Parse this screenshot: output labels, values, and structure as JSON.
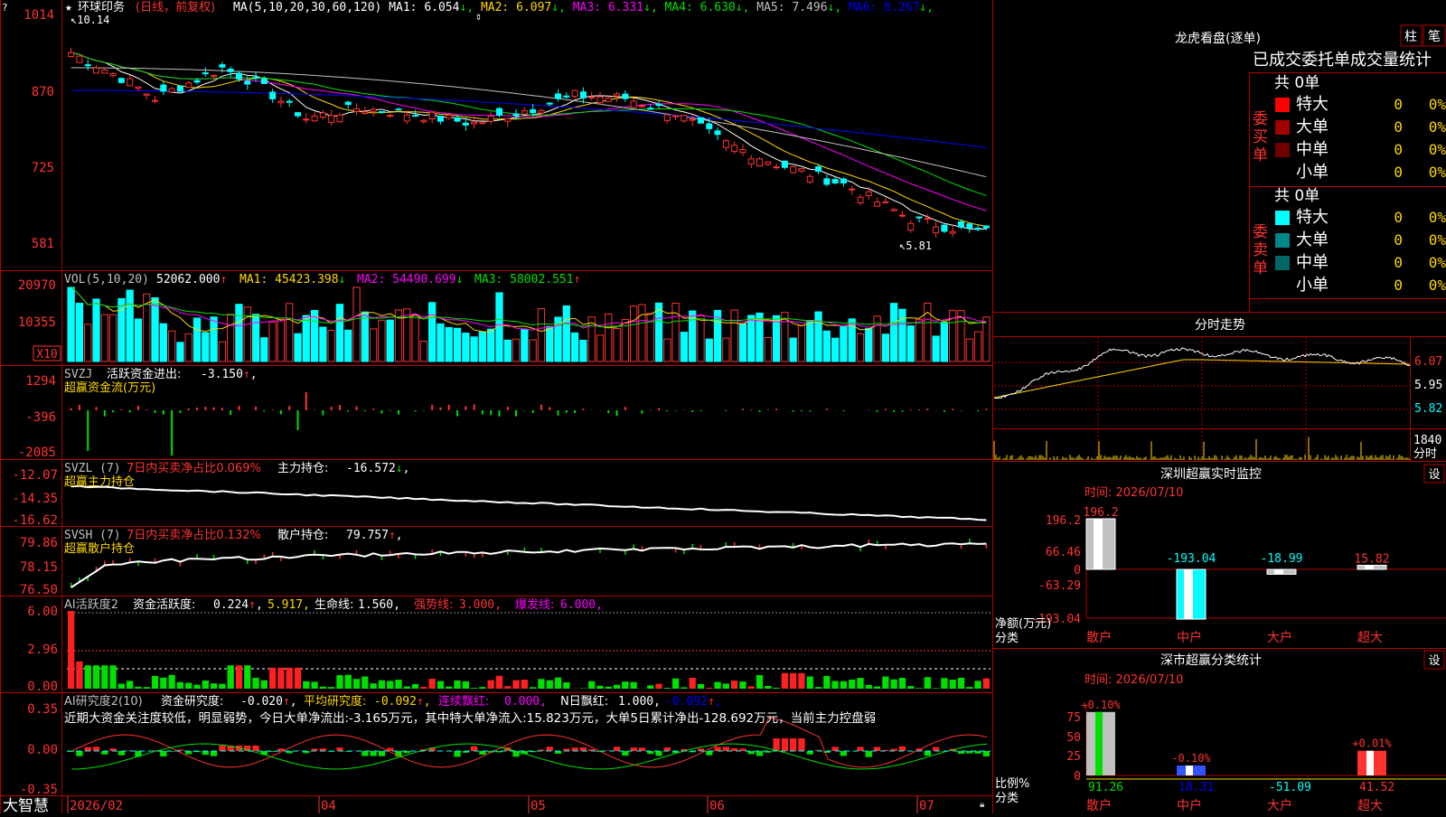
{
  "colors": {
    "up": "#ff3232",
    "down": "#00ffff",
    "green": "#00e000",
    "border": "#b00000",
    "yellow": "#ffd700",
    "white": "#ffffff",
    "magenta": "#ff00ff",
    "cyan": "#00ffff",
    "blue": "#0000ff",
    "gray": "#c0c0c0",
    "greenline": "#00c000"
  },
  "app": {
    "brand": "大智慧",
    "question_mark": "?"
  },
  "main": {
    "stock_name": "环球印务",
    "mode": "(日线，前复权)",
    "ma_label": "MA(5,10,20,30,60,120)",
    "ma_values": [
      {
        "key": "MA1:",
        "value": "6.054",
        "arrow": "↓",
        "color": "#ffffff"
      },
      {
        "key": "MA2:",
        "value": "6.097",
        "arrow": "↓",
        "color": "#ffd700"
      },
      {
        "key": "MA3:",
        "value": "6.331",
        "arrow": "↓",
        "color": "#ff00ff"
      },
      {
        "key": "MA4:",
        "value": "6.630",
        "arrow": "↓",
        "color": "#00e000"
      },
      {
        "key": "MA5:",
        "value": "7.496",
        "arrow": "↓",
        "color": "#c0c0c0"
      },
      {
        "key": "MA6:",
        "value": "8.267",
        "arrow": "↓",
        "color": "#0000ff"
      }
    ],
    "y_ticks": [
      "1014",
      "870",
      "725",
      "581"
    ],
    "high_label": "10.14",
    "low_label": "5.81"
  },
  "vol": {
    "label": "VOL(5,10,20)",
    "value": "52062.000",
    "arrow": "↑",
    "ma1": "MA1: 45423.398",
    "ma1_arrow": "↓",
    "ma2": "MA2: 54490.699",
    "ma2_arrow": "↓",
    "ma3": "MA3: 58002.551",
    "ma3_arrow": "↑",
    "y_ticks": [
      "20970",
      "10355"
    ],
    "unit": "X10"
  },
  "svzj": {
    "label": "SVZJ",
    "text1": "活跃资金进出:",
    "value": "-3.150",
    "arrow": "↑",
    "sub": "超赢资金流(万元)",
    "y_ticks": [
      "1294",
      "-396",
      "-2085"
    ]
  },
  "svzl": {
    "label": "SVZL (7)",
    "text1": "7日内买卖净占比0.069%",
    "text2": "主力持仓:",
    "value": "-16.572",
    "arrow": "↓",
    "sub": "超赢主力持仓",
    "y_ticks": [
      "-12.07",
      "-14.35",
      "-16.62"
    ]
  },
  "svsh": {
    "label": "SVSH (7)",
    "text1": "7日内买卖净占比0.132%",
    "text2": "散户持仓:",
    "value": "79.757",
    "arrow": "↑",
    "sub": "超赢散户持仓",
    "y_ticks": [
      "79.86",
      "78.15",
      "76.50"
    ]
  },
  "ai_act": {
    "label": "AI活跃度2",
    "k1": "资金活跃度:",
    "v1": "0.224",
    "a1": "↑",
    "v2": "5.917",
    "k3": "生命线:",
    "v3": "1.560",
    "k4": "强势线:",
    "v4": "3.000",
    "k5": "爆发线:",
    "v5": "6.000",
    "y_ticks": [
      "6.00",
      "2.96",
      "0.00"
    ]
  },
  "ai_res": {
    "label": "AI研究度2(10)",
    "k1": "资金研究度:",
    "v1": "-0.020",
    "a1": "↑",
    "k2": "平均研究度:",
    "v2": "-0.092",
    "a2": "↑",
    "k3": "连续飘红:",
    "v3": "0.000",
    "k4": "N日飘红:",
    "v4": "1.000",
    "v5": "-0.092",
    "a5": "↑",
    "comment": "近期大资金关注度较低，明显弱势，今日大单净流出:-3.165万元，其中特大单净流入:15.823万元，大单5日累计净出-128.692万元，当前主力控盘弱",
    "y_ticks": [
      "0.35",
      "0.00",
      "-0.35"
    ]
  },
  "x_axis": [
    "2026/02",
    "04",
    "05",
    "06",
    "07"
  ],
  "dragon": {
    "title": "龙虎看盘(逐单)",
    "btn_zhu": "柱",
    "btn_bi": "笔",
    "tabs": [
      "已成交",
      "委托单",
      "成交量统计"
    ],
    "buy": {
      "side": "委买单",
      "total": "共 0单",
      "rows": [
        {
          "name": "特大",
          "count": "0",
          "pct": "0%",
          "color": "#ff0000"
        },
        {
          "name": "大单",
          "count": "0",
          "pct": "0%",
          "color": "#a00000"
        },
        {
          "name": "中单",
          "count": "0",
          "pct": "0%",
          "color": "#700000"
        },
        {
          "name": "小单",
          "count": "0",
          "pct": "0%",
          "color": ""
        }
      ]
    },
    "sell": {
      "side": "委卖单",
      "total": "共 0单",
      "rows": [
        {
          "name": "特大",
          "count": "0",
          "pct": "0%",
          "color": "#00ffff"
        },
        {
          "name": "大单",
          "count": "0",
          "pct": "0%",
          "color": "#008888"
        },
        {
          "name": "中单",
          "count": "0",
          "pct": "0%",
          "color": "#006666"
        },
        {
          "name": "小单",
          "count": "0",
          "pct": "0%",
          "color": ""
        }
      ]
    }
  },
  "minute": {
    "title": "分时走势",
    "y_ticks": [
      "6.07",
      "5.95",
      "5.82"
    ],
    "vol_tick": "1840",
    "vol_unit": "分时"
  },
  "monitor": {
    "title": "深圳超赢实时监控",
    "set": "设",
    "time": "时间: 2026/07/10",
    "y_ticks": [
      "196.2",
      "66.46",
      "0",
      "-63.29",
      "-193.04"
    ],
    "unit_line1": "净额(万元)",
    "unit_line2": "分类",
    "categories": [
      "散户",
      "中户",
      "大户",
      "超大"
    ],
    "values": [
      "196.2",
      "-193.04",
      "-18.99",
      "15.82"
    ]
  },
  "stats": {
    "title": "深市超赢分类统计",
    "set": "设",
    "time": "时间: 2026/07/10",
    "y_ticks": [
      "75",
      "50",
      "25",
      "0"
    ],
    "unit_line1": "比例%",
    "unit_line2": "分类",
    "categories": [
      "散户",
      "中户",
      "大户",
      "超大"
    ],
    "top_labels": [
      "+0.10%",
      "-0.10%",
      "",
      "+0.01%"
    ],
    "values": [
      "91.26",
      "18.31",
      "-51.09",
      "41.52"
    ]
  }
}
